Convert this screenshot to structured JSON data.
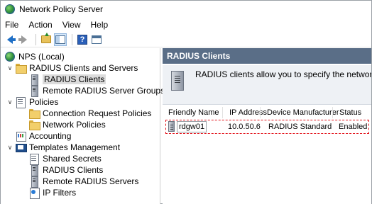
{
  "window": {
    "title": "Network Policy Server"
  },
  "menu": [
    "File",
    "Action",
    "View",
    "Help"
  ],
  "toolbar": {
    "icons": [
      "back-icon",
      "forward-icon",
      "up-folder-icon",
      "show-hide-console-tree-icon",
      "help-icon",
      "properties-icon"
    ]
  },
  "tree": {
    "root": "NPS (Local)",
    "radius_clients_servers": "RADIUS Clients and Servers",
    "radius_clients": "RADIUS Clients",
    "remote_groups": "Remote RADIUS Server Groups",
    "policies": "Policies",
    "conn_request_policies": "Connection Request Policies",
    "network_policies": "Network Policies",
    "accounting": "Accounting",
    "templates_management": "Templates Management",
    "shared_secrets": "Shared Secrets",
    "tmpl_radius_clients": "RADIUS Clients",
    "tmpl_remote_servers": "Remote RADIUS Servers",
    "ip_filters": "IP Filters"
  },
  "right": {
    "header": "RADIUS Clients",
    "info_text": "RADIUS clients allow you to specify the network access se",
    "columns": [
      "Friendly Name",
      "IP Address",
      "Device Manufacturer",
      "Status"
    ],
    "rows": [
      {
        "friendly_name": "rdgw01",
        "ip_address": "10.0.50.6",
        "device_manufacturer": "RADIUS Standard",
        "status": "Enabled"
      }
    ]
  },
  "colors": {
    "header_bg": "#5a6e87",
    "highlight_border": "#e2121a",
    "selected_bg": "#dcdcdc"
  }
}
